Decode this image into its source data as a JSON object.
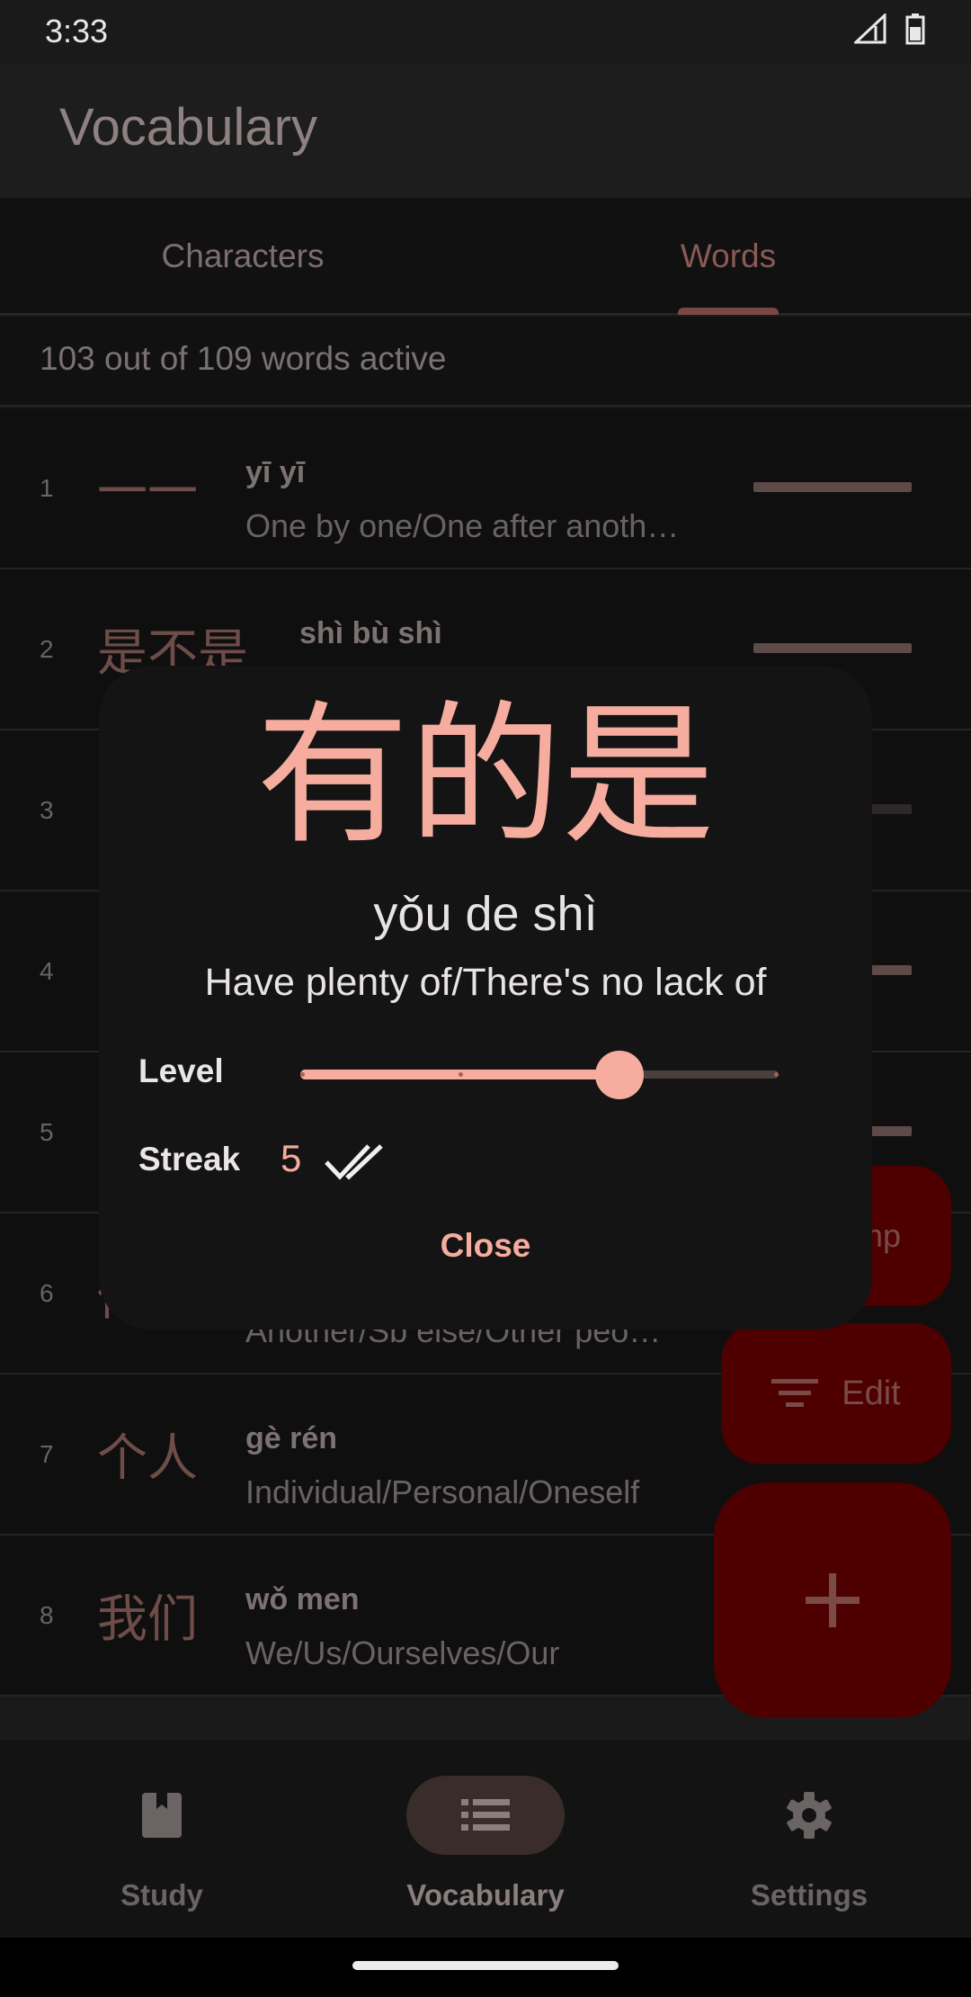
{
  "status_bar": {
    "time": "3:33"
  },
  "app_bar": {
    "title": "Vocabulary"
  },
  "tabs": [
    {
      "label": "Characters",
      "selected": false
    },
    {
      "label": "Words",
      "selected": true
    }
  ],
  "summary": "103 out of 109 words active",
  "words": [
    {
      "num": "1",
      "hanzi": "一一",
      "pinyin": "yī yī",
      "meaning": "One by one/One after anoth…"
    },
    {
      "num": "2",
      "hanzi": "是不是",
      "pinyin": "shì bù shì",
      "meaning": ""
    },
    {
      "num": "3",
      "hanzi": "",
      "pinyin": "",
      "meaning": ""
    },
    {
      "num": "4",
      "hanzi": "",
      "pinyin": "",
      "meaning": ""
    },
    {
      "num": "5",
      "hanzi": "",
      "pinyin": "",
      "meaning": ""
    },
    {
      "num": "6",
      "hanzi": "他人",
      "pinyin": "",
      "meaning": "Another/Sb else/Other peo…"
    },
    {
      "num": "7",
      "hanzi": "个人",
      "pinyin": "gè rén",
      "meaning": "Individual/Personal/Oneself"
    },
    {
      "num": "8",
      "hanzi": "我们",
      "pinyin": "wǒ men",
      "meaning": "We/Us/Ourselves/Our"
    }
  ],
  "fabs": {
    "jump_label": "mp",
    "edit_label": "Edit",
    "add_icon": "plus-icon"
  },
  "bottom_nav": [
    {
      "label": "Study",
      "icon": "book-icon",
      "active": false
    },
    {
      "label": "Vocabulary",
      "icon": "list-icon",
      "active": true
    },
    {
      "label": "Settings",
      "icon": "gear-icon",
      "active": false
    }
  ],
  "dialog": {
    "hanzi": "有的是",
    "pinyin": "yǒu de shì",
    "meaning": "Have plenty of/There's no lack of",
    "level_label": "Level",
    "level_fraction": 0.667,
    "streak_label": "Streak",
    "streak_value": "5",
    "streak_icon": "double-check-icon",
    "close_label": "Close"
  },
  "colors": {
    "accent": "#f6ad9f",
    "fab_background": "#4e0000",
    "dialog_background": "#141414"
  }
}
